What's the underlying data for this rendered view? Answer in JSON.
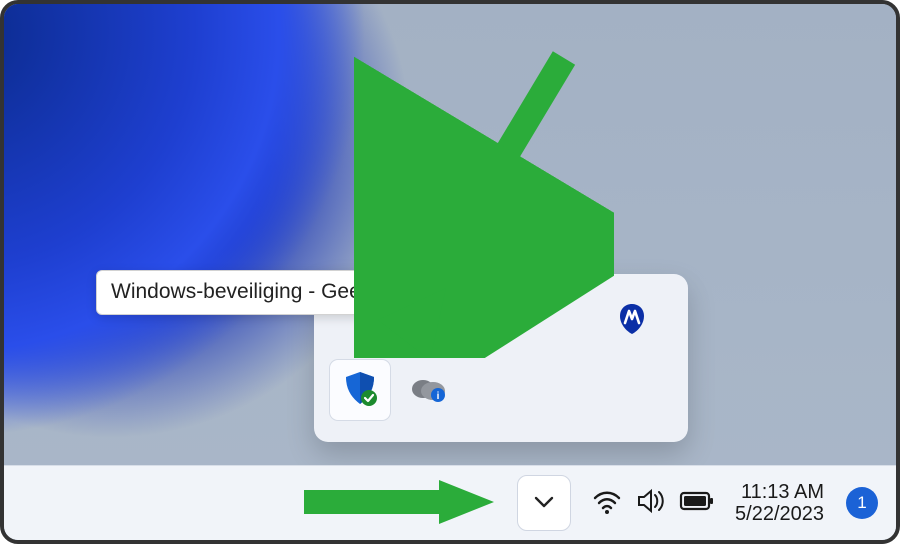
{
  "tooltip": {
    "text": "Windows-beveiliging - Geen acties vereist."
  },
  "tray_flyout": {
    "icons": [
      {
        "name": "malwarebytes-icon"
      },
      {
        "name": "windows-security-icon"
      },
      {
        "name": "onedrive-icon"
      }
    ]
  },
  "taskbar": {
    "chevron_label": "Show hidden icons",
    "clock": {
      "time": "11:13 AM",
      "date": "5/22/2023"
    },
    "notification_count": "1"
  },
  "colors": {
    "accent": "#1b62d6",
    "arrow": "#2bac3a"
  }
}
